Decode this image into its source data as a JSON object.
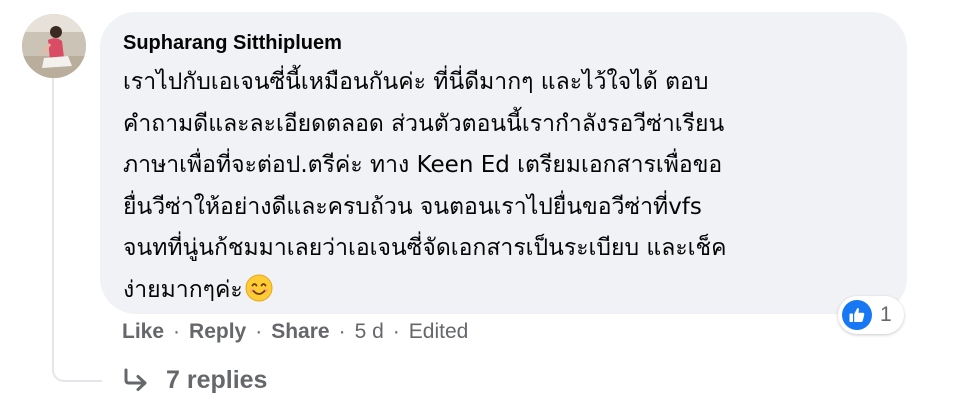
{
  "comment": {
    "author": "Supharang Sitthipluem",
    "text_lines": [
      "เราไปกับเอเจนซี่นี้เหมือนกันค่ะ ที่นี่ดีมากๆ และไว้ใจได้ ตอบ",
      "คำถามดีและละเอียดตลอด ส่วนตัวตอนนี้เรากำลังรอวีซ่าเรียน",
      "ภาษาเพื่อที่จะต่อป.ตรีค่ะ ทาง Keen Ed เตรียมเอกสารเพื่อขอ",
      "ยื่นวีซ่าให้อย่างดีและครบถ้วน จนตอนเราไปยื่นขอวีซ่าที่vfs",
      "จนทที่นู่นก้ชมมาเลยว่าเอเจนซี่จัดเอกสารเป็นระเบียบ และเช็ค",
      "ง่ายมากๆค่ะ"
    ],
    "emoji": "smiling-face-emoji",
    "reaction_icon": "thumbs-up-icon",
    "reaction_count": "1",
    "actions": {
      "like": "Like",
      "reply": "Reply",
      "share": "Share",
      "separator": "·",
      "time": "5 d",
      "edited": "Edited"
    },
    "replies_label": "7 replies",
    "replies_icon": "reply-arrow-icon"
  },
  "colors": {
    "bubble_bg": "#f0f2f5",
    "meta_text": "#65676b",
    "like_blue": "#1877f2",
    "thread_line": "#e4e6eb"
  }
}
